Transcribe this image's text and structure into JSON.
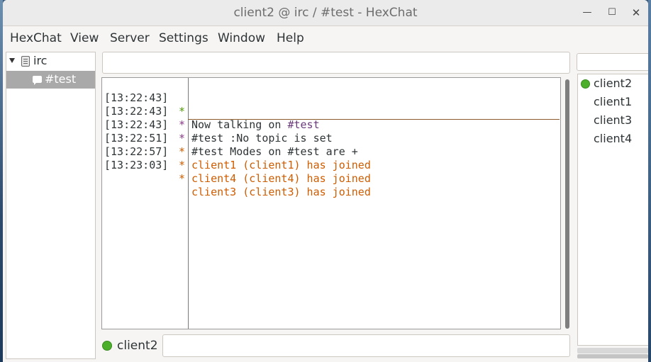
{
  "window": {
    "title": "client2 @ irc / #test - HexChat",
    "minimize_glyph": "—",
    "maximize_glyph": "☐",
    "close_glyph": "✕"
  },
  "menu": [
    "HexChat",
    "View",
    "Server",
    "Settings",
    "Window",
    "Help"
  ],
  "tree": {
    "network": "irc",
    "channel": "#test",
    "network_icon": "server-icon",
    "channel_icon": "chat-icon"
  },
  "chat": {
    "lines": [
      {
        "time": "[13:22:43]",
        "star": "*",
        "text_a": "Now talking on ",
        "text_b": "#test",
        "kind": "talking"
      },
      {
        "time": "[13:22:43]",
        "star": "*",
        "text_a": "#test :No topic is set",
        "text_b": "",
        "kind": "topic"
      },
      {
        "time": "[13:22:43]",
        "star": "*",
        "text_a": "#test Modes on #test are +",
        "text_b": "",
        "kind": "modes"
      },
      {
        "time": "[13:22:51]",
        "star": "*",
        "text_a": "client1 (client1) has joined",
        "text_b": "",
        "kind": "join"
      },
      {
        "time": "[13:22:57]",
        "star": "*",
        "text_a": "client4 (client4) has joined",
        "text_b": "",
        "kind": "join"
      },
      {
        "time": "[13:23:03]",
        "star": "*",
        "text_a": "client3 (client3) has joined",
        "text_b": "",
        "kind": "join"
      }
    ]
  },
  "input": {
    "nick": "client2",
    "value": ""
  },
  "users": [
    {
      "name": "client2",
      "online_dot": true
    },
    {
      "name": "client1",
      "online_dot": false
    },
    {
      "name": "client3",
      "online_dot": false
    },
    {
      "name": "client4",
      "online_dot": false
    }
  ],
  "colors": {
    "join": "#ce5c00",
    "star_talking": "#4e9a06",
    "star_other": "#8b3a8b",
    "online": "#4caf2a"
  }
}
